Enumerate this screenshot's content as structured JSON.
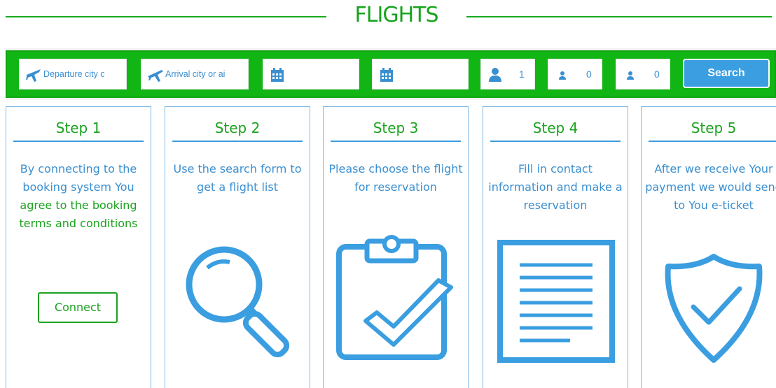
{
  "header": {
    "title": "FLIGHTS"
  },
  "search": {
    "departure_placeholder": "Departure city c",
    "arrival_placeholder": "Arrival city or ai",
    "adults": "1",
    "children": "0",
    "infants": "0",
    "button_label": "Search"
  },
  "steps": [
    {
      "title": "Step 1",
      "desc_plain": "By connecting to the booking system You",
      "desc_link": "agree to the booking terms and conditions",
      "button": "Connect"
    },
    {
      "title": "Step 2",
      "desc": "Use the search form to get a flight list"
    },
    {
      "title": "Step 3",
      "desc": "Please choose the flight for reservation"
    },
    {
      "title": "Step 4",
      "desc": "Fill in contact information and make a reservation"
    },
    {
      "title": "Step 5",
      "desc": "After we receive Your payment we would send to You e-ticket"
    }
  ],
  "colors": {
    "green": "#1ba21f",
    "bar_green": "#11b514",
    "blue": "#3a9ee0"
  },
  "icons": [
    "plane-departure-icon",
    "plane-arrival-icon",
    "calendar-icon",
    "adult-icon",
    "child-icon",
    "infant-icon",
    "magnifier-icon",
    "clipboard-check-icon",
    "document-icon",
    "shield-check-icon"
  ]
}
